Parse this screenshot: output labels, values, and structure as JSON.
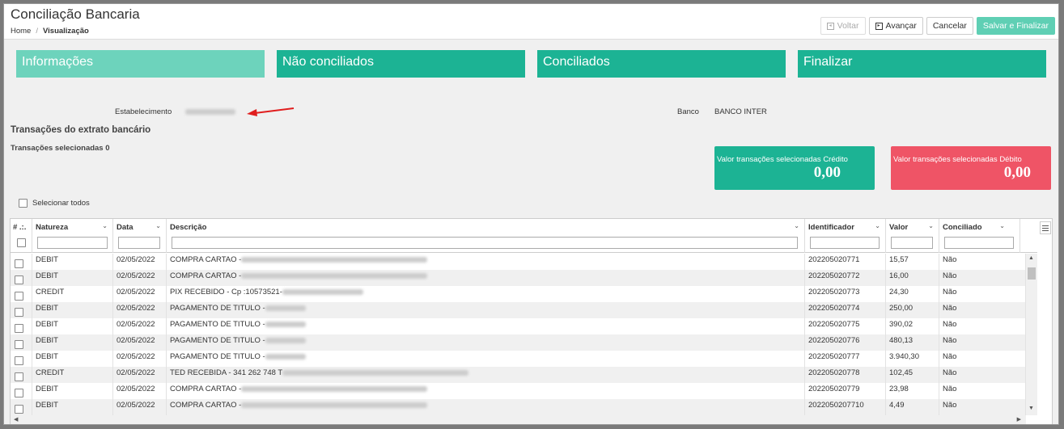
{
  "header": {
    "title": "Conciliação Bancaria",
    "breadcrumb": [
      "Home",
      "Visualização"
    ]
  },
  "toolbar": {
    "back_label": "Voltar",
    "next_label": "Avançar",
    "cancel_label": "Cancelar",
    "save_label": "Salvar e Finalizar"
  },
  "steps": [
    "Informações",
    "Não conciliados",
    "Conciliados",
    "Finalizar"
  ],
  "info": {
    "establishment_label": "Estabelecimento",
    "bank_label": "Banco",
    "bank_value": "BANCO INTER"
  },
  "section": {
    "title": "Transações do extrato bancário",
    "selected_count": "Transações selecionadas 0"
  },
  "cards": {
    "credit_label": "Valor transações selecionadas Crédito",
    "credit_value": "0,00",
    "debit_label": "Valor transações selecionadas Débito",
    "debit_value": "0,00"
  },
  "select_all_label": "Selecionar todos",
  "colors": {
    "accent": "#1cb394",
    "accent_light": "#6dd3bc",
    "danger": "#ef5466"
  },
  "grid": {
    "columns": [
      "# .:.",
      "Natureza",
      "Data",
      "Descrição",
      "Identificador",
      "Valor",
      "Conciliado"
    ],
    "rows": [
      {
        "natureza": "DEBIT",
        "data": "02/05/2022",
        "desc": "COMPRA CARTAO -",
        "id": "202205020771",
        "valor": "15,57",
        "conc": "Não"
      },
      {
        "natureza": "DEBIT",
        "data": "02/05/2022",
        "desc": "COMPRA CARTAO -",
        "id": "202205020772",
        "valor": "16,00",
        "conc": "Não"
      },
      {
        "natureza": "CREDIT",
        "data": "02/05/2022",
        "desc": "PIX RECEBIDO - Cp :10573521-",
        "id": "202205020773",
        "valor": "24,30",
        "conc": "Não"
      },
      {
        "natureza": "DEBIT",
        "data": "02/05/2022",
        "desc": "PAGAMENTO DE TITULO -",
        "id": "202205020774",
        "valor": "250,00",
        "conc": "Não"
      },
      {
        "natureza": "DEBIT",
        "data": "02/05/2022",
        "desc": "PAGAMENTO DE TITULO -",
        "id": "202205020775",
        "valor": "390,02",
        "conc": "Não"
      },
      {
        "natureza": "DEBIT",
        "data": "02/05/2022",
        "desc": "PAGAMENTO DE TITULO -",
        "id": "202205020776",
        "valor": "480,13",
        "conc": "Não"
      },
      {
        "natureza": "DEBIT",
        "data": "02/05/2022",
        "desc": "PAGAMENTO DE TITULO -",
        "id": "202205020777",
        "valor": "3.940,30",
        "conc": "Não"
      },
      {
        "natureza": "CREDIT",
        "data": "02/05/2022",
        "desc": "TED RECEBIDA - 341 262 748 T",
        "id": "202205020778",
        "valor": "102,45",
        "conc": "Não"
      },
      {
        "natureza": "DEBIT",
        "data": "02/05/2022",
        "desc": "COMPRA CARTAO -",
        "id": "202205020779",
        "valor": "23,98",
        "conc": "Não"
      },
      {
        "natureza": "DEBIT",
        "data": "02/05/2022",
        "desc": "COMPRA CARTAO -",
        "id": "2022050207710",
        "valor": "4,49",
        "conc": "Não"
      }
    ]
  }
}
